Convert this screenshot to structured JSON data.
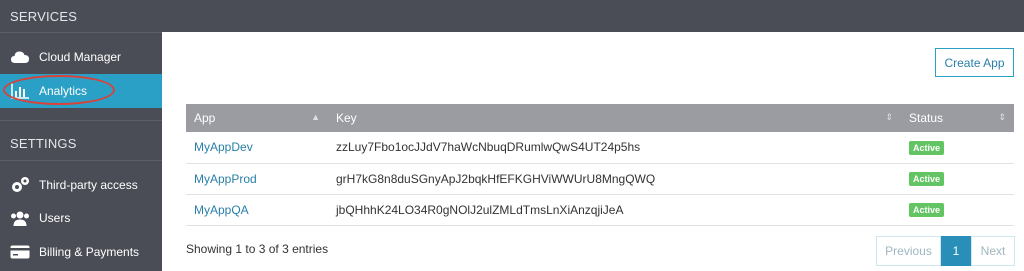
{
  "sidebar": {
    "services_title": "SERVICES",
    "settings_title": "SETTINGS",
    "items": [
      {
        "label": "Cloud Manager",
        "icon": "cloud-icon"
      },
      {
        "label": "Analytics",
        "icon": "bar-chart-icon",
        "active": true
      },
      {
        "label": "Third-party access",
        "icon": "gears-icon"
      },
      {
        "label": "Users",
        "icon": "users-icon"
      },
      {
        "label": "Billing & Payments",
        "icon": "credit-card-icon"
      }
    ]
  },
  "main": {
    "create_label": "Create App",
    "table": {
      "headers": [
        "App",
        "Key",
        "Status"
      ],
      "rows": [
        {
          "app": "MyAppDev",
          "key": "zzLuy7Fbo1ocJJdV7haWcNbuqDRumlwQwS4UT24p5hs",
          "status": "Active"
        },
        {
          "app": "MyAppProd",
          "key": "grH7kG8n8duSGnyApJ2bqkHfEFKGHViWWUrU8MngQWQ",
          "status": "Active"
        },
        {
          "app": "MyAppQA",
          "key": "jbQHhhK24LO34R0gNOlJ2ulZMLdTmsLnXiAnzqjiJeA",
          "status": "Active"
        }
      ]
    },
    "info": "Showing 1 to 3 of 3 entries",
    "pagination": {
      "previous": "Previous",
      "current": "1",
      "next": "Next"
    }
  },
  "colors": {
    "accent": "#2aa0c7",
    "sidebar": "#4a4d55",
    "active_badge": "#62c462",
    "annotation": "#d9423a"
  }
}
